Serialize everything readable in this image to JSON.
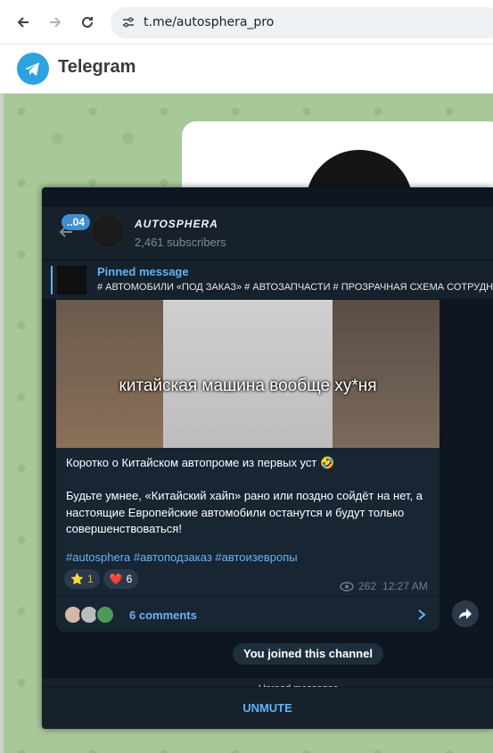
{
  "browser": {
    "url": "t.me/autosphera_pro"
  },
  "telegram": {
    "title": "Telegram"
  },
  "channel": {
    "unread_count": "..04",
    "name": "AUTOSPHERA",
    "subscribers": "2,461 subscribers"
  },
  "pinned": {
    "title": "Pinned message",
    "text": "# АВТОМОБИЛИ «ПОД ЗАКАЗ» # АВТОЗАПЧАСТИ  # ПРОЗРАЧНАЯ СХЕМА СОТРУДНИЧ"
  },
  "message": {
    "video_caption": "китайская машина вообще ху*ня",
    "paragraph1": "Коротко о Китайском автопроме из первых уст 🤣",
    "paragraph2": "Будьте умнее, «Китайский хайп» рано или поздно сойдёт на нет, а настоящие Европейские автомобили останутся и будут только совершенствоваться!",
    "hashtags": "#autosphera #автоподзаказ #автоизевропы",
    "reactions": [
      {
        "emoji": "⭐",
        "count": "1"
      },
      {
        "emoji": "❤️",
        "count": "6"
      }
    ],
    "views": "262",
    "time": "12:27 AM",
    "comments": "6 comments"
  },
  "joined_notice": "You joined this channel",
  "unread_separator": "Unread messages",
  "unmute_label": "UNMUTE"
}
